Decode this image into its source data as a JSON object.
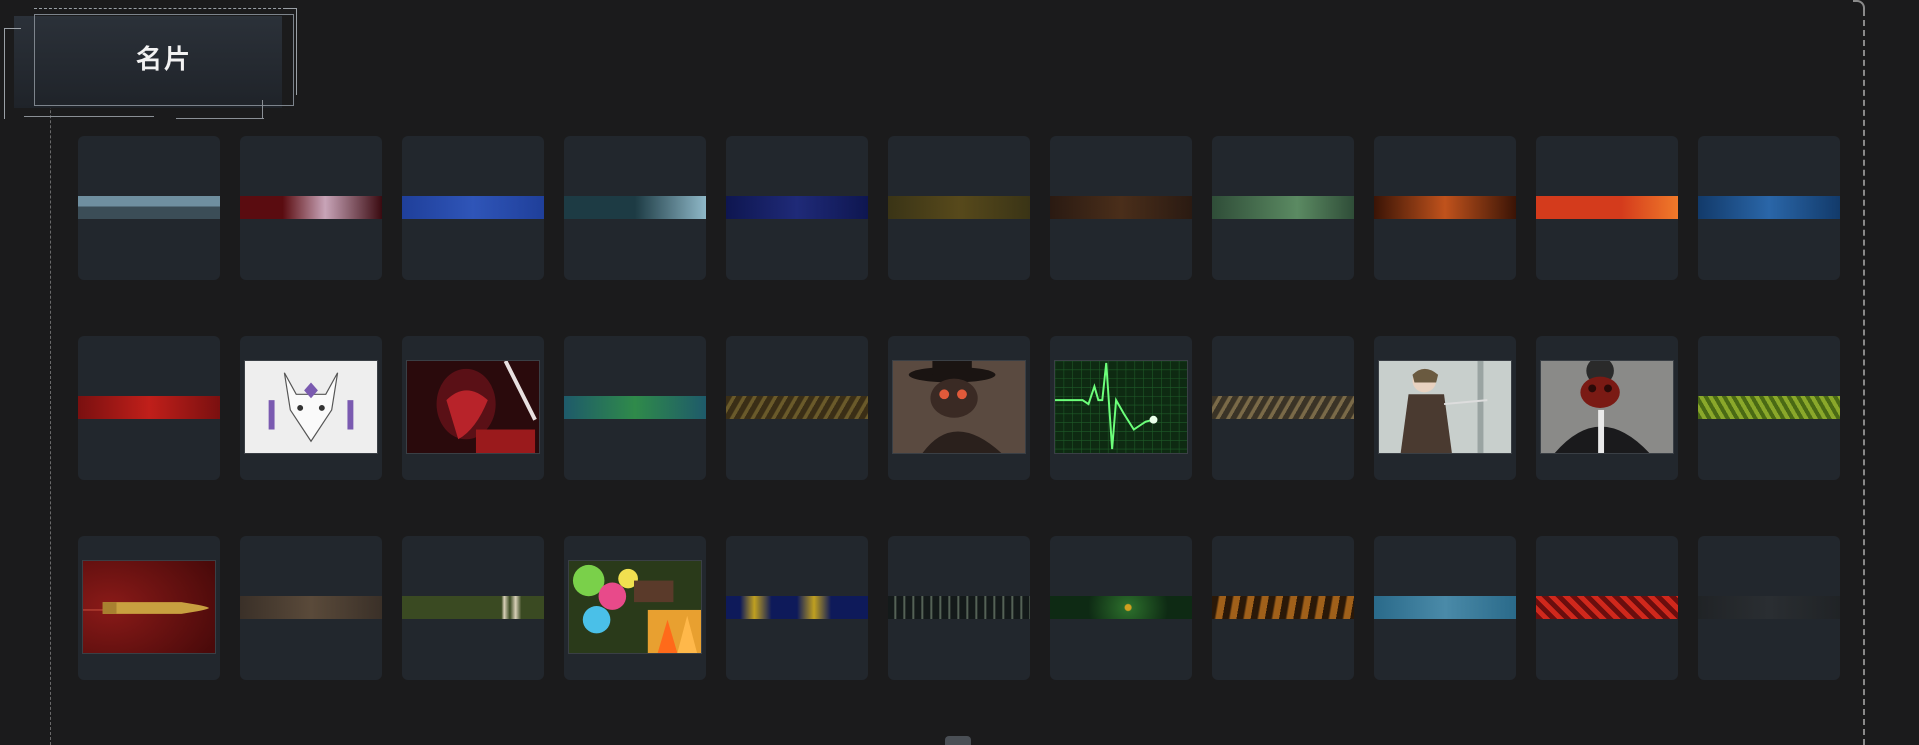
{
  "title": "名片",
  "rows": [
    [
      {
        "id": "card-1-1",
        "style": "banner",
        "icon": "mountain-silhouette-banner",
        "colors": [
          "#6f8fa0",
          "#3b4d57"
        ]
      },
      {
        "id": "card-1-2",
        "style": "banner",
        "icon": "red-floral-banner",
        "colors": [
          "#5a0c10",
          "#c8a4b8"
        ]
      },
      {
        "id": "card-1-3",
        "style": "banner",
        "icon": "blue-textured-banner",
        "colors": [
          "#1f3f9a",
          "#2f55b8"
        ]
      },
      {
        "id": "card-1-4",
        "style": "banner",
        "icon": "teal-wolf-banner",
        "colors": [
          "#1d3b44",
          "#8fb8c8"
        ]
      },
      {
        "id": "card-1-5",
        "style": "banner",
        "icon": "navy-swirl-banner",
        "colors": [
          "#0e1650",
          "#1f2a78"
        ]
      },
      {
        "id": "card-1-6",
        "style": "banner",
        "icon": "olive-pattern-banner",
        "colors": [
          "#3a3416",
          "#57491b"
        ]
      },
      {
        "id": "card-1-7",
        "style": "banner",
        "icon": "brown-ornament-banner",
        "colors": [
          "#2a1a12",
          "#4a2e1a"
        ]
      },
      {
        "id": "card-1-8",
        "style": "banner",
        "icon": "green-handprint-banner",
        "colors": [
          "#2f4d38",
          "#5b8a62"
        ]
      },
      {
        "id": "card-1-9",
        "style": "banner",
        "icon": "orange-ornate-banner",
        "colors": [
          "#3a1406",
          "#c0521c"
        ]
      },
      {
        "id": "card-1-10",
        "style": "banner",
        "icon": "orange-red-gradient-banner",
        "colors": [
          "#d43b1c",
          "#f07a2a"
        ]
      },
      {
        "id": "card-1-11",
        "style": "banner",
        "icon": "blue-camo-banner",
        "colors": [
          "#123a6a",
          "#2a66a8"
        ]
      }
    ],
    [
      {
        "id": "card-2-1",
        "style": "banner",
        "icon": "red-smoke-banner",
        "colors": [
          "#7a1010",
          "#c01f1a"
        ]
      },
      {
        "id": "card-2-2",
        "style": "picture",
        "icon": "white-fox-mask-image",
        "colors": [
          "#eeeeee",
          "#7a5ab0"
        ]
      },
      {
        "id": "card-2-3",
        "style": "picture",
        "icon": "red-demon-face-image",
        "colors": [
          "#2a0a0c",
          "#b8232a"
        ]
      },
      {
        "id": "card-2-4",
        "style": "banner",
        "icon": "green-blue-camo-banner",
        "colors": [
          "#1e5a6a",
          "#2f8a4a"
        ]
      },
      {
        "id": "card-2-5",
        "style": "banner",
        "icon": "gold-filigree-banner",
        "colors": [
          "#3a2e16",
          "#6a5a2a"
        ]
      },
      {
        "id": "card-2-6",
        "style": "picture",
        "icon": "plague-doctor-image",
        "colors": [
          "#3a2a24",
          "#e05a3a"
        ]
      },
      {
        "id": "card-2-7",
        "style": "picture",
        "icon": "heartbeat-monitor-image",
        "colors": [
          "#0e2a12",
          "#6cff7a"
        ]
      },
      {
        "id": "card-2-8",
        "style": "banner",
        "icon": "tan-wavy-banner",
        "colors": [
          "#3a3326",
          "#7a6a48"
        ]
      },
      {
        "id": "card-2-9",
        "style": "picture",
        "icon": "knife-girl-image",
        "colors": [
          "#c8cfcc",
          "#4a3a30"
        ]
      },
      {
        "id": "card-2-10",
        "style": "picture",
        "icon": "gas-mask-man-image",
        "colors": [
          "#8a8a88",
          "#7a1a14"
        ]
      },
      {
        "id": "card-2-11",
        "style": "banner",
        "icon": "lime-scale-banner",
        "colors": [
          "#4a6a14",
          "#8aa82a"
        ]
      }
    ],
    [
      {
        "id": "card-3-1",
        "style": "picture",
        "icon": "bullet-image",
        "colors": [
          "#4a0a0a",
          "#c8a040"
        ]
      },
      {
        "id": "card-3-2",
        "style": "banner",
        "icon": "dusty-brown-banner",
        "colors": [
          "#3a3028",
          "#5a4a3a"
        ]
      },
      {
        "id": "card-3-3",
        "style": "banner",
        "icon": "shark-teeth-camo-banner",
        "colors": [
          "#3a4a22",
          "#d8d0b8"
        ]
      },
      {
        "id": "card-3-4",
        "style": "picture",
        "icon": "colorful-battle-image",
        "colors": [
          "#3a6a2a",
          "#e8a030"
        ]
      },
      {
        "id": "card-3-5",
        "style": "banner",
        "icon": "blue-yellow-waves-banner",
        "colors": [
          "#0e1a5a",
          "#c0a020"
        ]
      },
      {
        "id": "card-3-6",
        "style": "banner",
        "icon": "black-teeth-banner",
        "colors": [
          "#141a1a",
          "#6a7a6a"
        ]
      },
      {
        "id": "card-3-7",
        "style": "banner",
        "icon": "green-eye-banner",
        "colors": [
          "#0e2a14",
          "#2a6a2a"
        ]
      },
      {
        "id": "card-3-8",
        "style": "banner",
        "icon": "tiger-stripe-banner",
        "colors": [
          "#2a1808",
          "#a0601a"
        ]
      },
      {
        "id": "card-3-9",
        "style": "banner",
        "icon": "cyan-blue-banner",
        "colors": [
          "#2a6a8a",
          "#4a8aa8"
        ]
      },
      {
        "id": "card-3-10",
        "style": "banner",
        "icon": "red-zigzag-banner",
        "colors": [
          "#6a0e0e",
          "#d0281c"
        ]
      },
      {
        "id": "card-3-11",
        "style": "banner",
        "icon": "dark-grey-banner",
        "colors": [
          "#202326",
          "#2a2e32"
        ]
      }
    ]
  ]
}
